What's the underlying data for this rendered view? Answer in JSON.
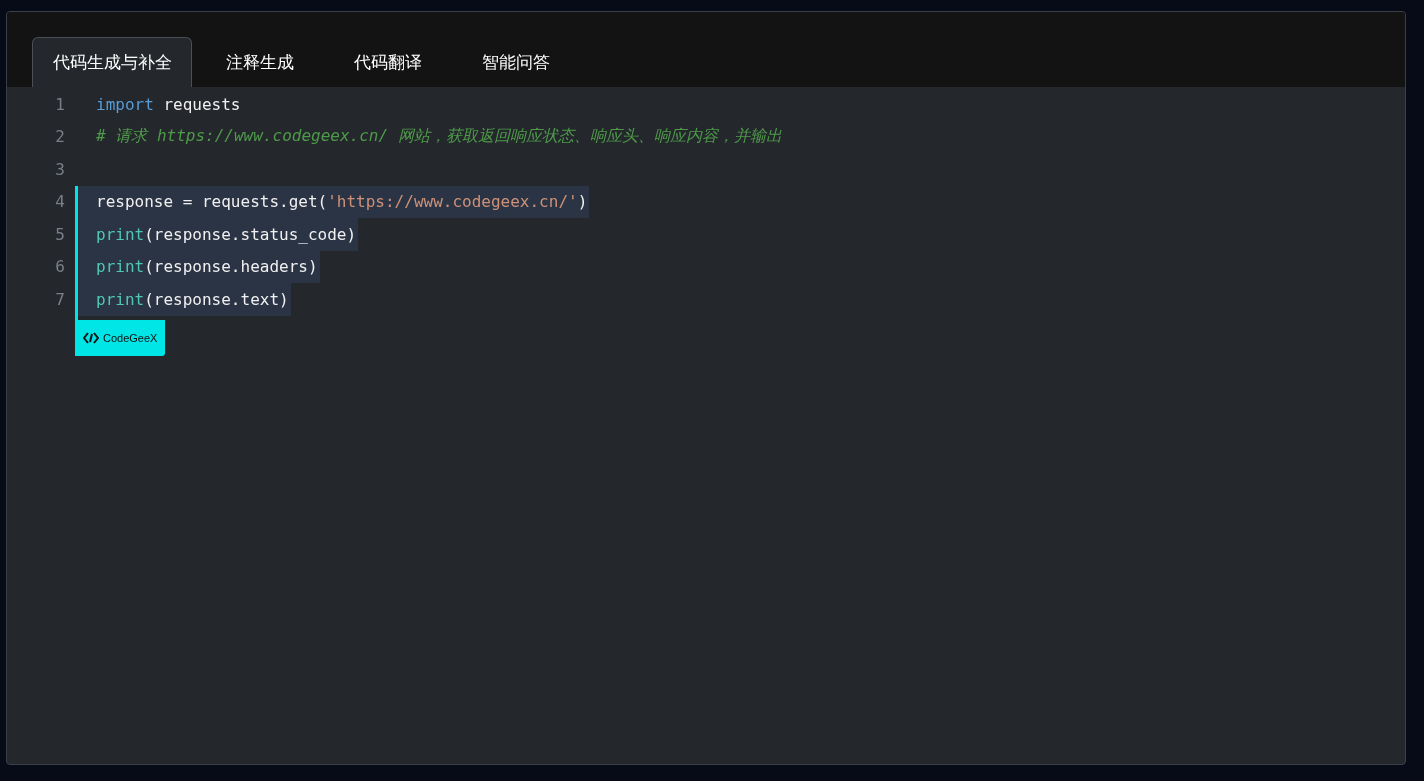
{
  "tabs": [
    {
      "label": "代码生成与补全",
      "selected": true
    },
    {
      "label": "注释生成",
      "selected": false
    },
    {
      "label": "代码翻译",
      "selected": false
    },
    {
      "label": "智能问答",
      "selected": false
    }
  ],
  "editor": {
    "lines": [
      {
        "number": "1",
        "tokens": [
          {
            "kind": "keyword",
            "text": "import"
          },
          {
            "kind": "plain",
            "text": " requests"
          }
        ]
      },
      {
        "number": "2",
        "tokens": [
          {
            "kind": "comment",
            "text": "# 请求 https://www.codegeex.cn/ 网站，获取返回响应状态、响应头、响应内容，并输出"
          }
        ]
      },
      {
        "number": "3"
      }
    ],
    "suggestion": {
      "lines": [
        {
          "number": "4",
          "tokens": [
            {
              "kind": "plain",
              "text": "response = requests.get("
            },
            {
              "kind": "string",
              "text": "'https://www.codegeex.cn/'"
            },
            {
              "kind": "plain",
              "text": ")"
            }
          ]
        },
        {
          "number": "5",
          "tokens": [
            {
              "kind": "builtin",
              "text": "print"
            },
            {
              "kind": "plain",
              "text": "(response.status_code)"
            }
          ]
        },
        {
          "number": "6",
          "tokens": [
            {
              "kind": "builtin",
              "text": "print"
            },
            {
              "kind": "plain",
              "text": "(response.headers)"
            }
          ]
        },
        {
          "number": "7",
          "tokens": [
            {
              "kind": "builtin",
              "text": "print"
            },
            {
              "kind": "plain",
              "text": "(response.text)"
            }
          ]
        }
      ],
      "badge": "CodeGeeX"
    }
  }
}
